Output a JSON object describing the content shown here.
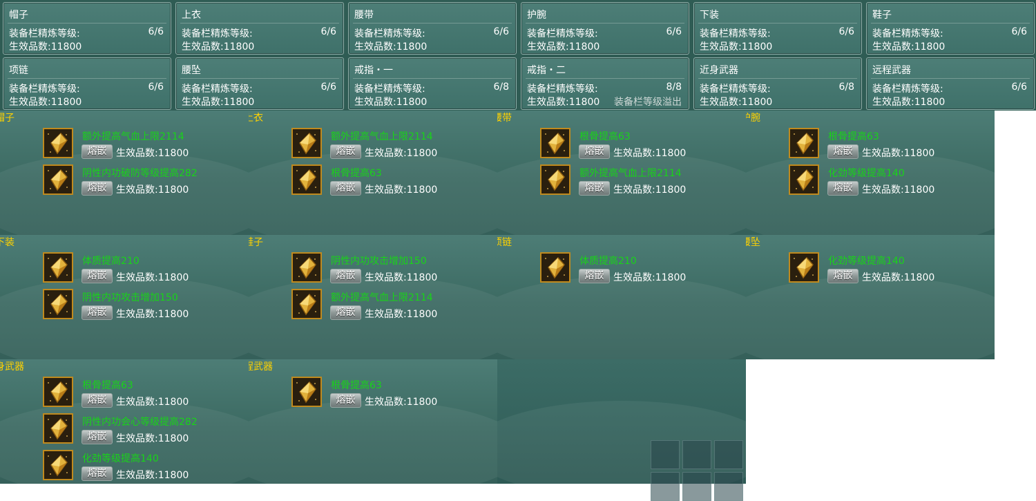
{
  "slots": [
    {
      "name": "帽子",
      "level_label": "装备栏精炼等级:",
      "level": "6/6",
      "count_label": "生效品数:",
      "count": "11800",
      "note": ""
    },
    {
      "name": "上衣",
      "level_label": "装备栏精炼等级:",
      "level": "6/6",
      "count_label": "生效品数:",
      "count": "11800",
      "note": ""
    },
    {
      "name": "腰带",
      "level_label": "装备栏精炼等级:",
      "level": "6/6",
      "count_label": "生效品数:",
      "count": "11800",
      "note": ""
    },
    {
      "name": "护腕",
      "level_label": "装备栏精炼等级:",
      "level": "6/6",
      "count_label": "生效品数:",
      "count": "11800",
      "note": ""
    },
    {
      "name": "下装",
      "level_label": "装备栏精炼等级:",
      "level": "6/6",
      "count_label": "生效品数:",
      "count": "11800",
      "note": ""
    },
    {
      "name": "鞋子",
      "level_label": "装备栏精炼等级:",
      "level": "6/6",
      "count_label": "生效品数:",
      "count": "11800",
      "note": ""
    },
    {
      "name": "项链",
      "level_label": "装备栏精炼等级:",
      "level": "6/6",
      "count_label": "生效品数:",
      "count": "11800",
      "note": ""
    },
    {
      "name": "腰坠",
      "level_label": "装备栏精炼等级:",
      "level": "6/6",
      "count_label": "生效品数:",
      "count": "11800",
      "note": ""
    },
    {
      "name": "戒指・一",
      "level_label": "装备栏精炼等级:",
      "level": "6/8",
      "count_label": "生效品数:",
      "count": "11800",
      "note": ""
    },
    {
      "name": "戒指・二",
      "level_label": "装备栏精炼等级:",
      "level": "8/8",
      "count_label": "生效品数:",
      "count": "11800",
      "note": "装备栏等级溢出"
    },
    {
      "name": "近身武器",
      "level_label": "装备栏精炼等级:",
      "level": "6/8",
      "count_label": "生效品数:",
      "count": "11800",
      "note": ""
    },
    {
      "name": "远程武器",
      "level_label": "装备栏精炼等级:",
      "level": "6/6",
      "count_label": "生效品数:",
      "count": "11800",
      "note": ""
    }
  ],
  "panels": [
    {
      "title": "帽子",
      "gems": [
        {
          "effect": "额外提高气血上限2114",
          "button": "熔嵌",
          "count_label": "生效品数:",
          "count": "11800"
        },
        {
          "effect": "阴性内功破防等级提高282",
          "button": "熔嵌",
          "count_label": "生效品数:",
          "count": "11800"
        }
      ]
    },
    {
      "title": "上衣",
      "gems": [
        {
          "effect": "额外提高气血上限2114",
          "button": "熔嵌",
          "count_label": "生效品数:",
          "count": "11800"
        },
        {
          "effect": "根骨提高63",
          "button": "熔嵌",
          "count_label": "生效品数:",
          "count": "11800"
        }
      ]
    },
    {
      "title": "腰带",
      "gems": [
        {
          "effect": "根骨提高63",
          "button": "熔嵌",
          "count_label": "生效品数:",
          "count": "11800"
        },
        {
          "effect": "额外提高气血上限2114",
          "button": "熔嵌",
          "count_label": "生效品数:",
          "count": "11800"
        }
      ]
    },
    {
      "title": "护腕",
      "gems": [
        {
          "effect": "根骨提高63",
          "button": "熔嵌",
          "count_label": "生效品数:",
          "count": "11800"
        },
        {
          "effect": "化劲等级提高140",
          "button": "熔嵌",
          "count_label": "生效品数:",
          "count": "11800"
        }
      ]
    },
    {
      "title": "下装",
      "gems": [
        {
          "effect": "体质提高210",
          "button": "熔嵌",
          "count_label": "生效品数:",
          "count": "11800"
        },
        {
          "effect": "阴性内功攻击增加150",
          "button": "熔嵌",
          "count_label": "生效品数:",
          "count": "11800"
        }
      ]
    },
    {
      "title": "鞋子",
      "gems": [
        {
          "effect": "阴性内功攻击增加150",
          "button": "熔嵌",
          "count_label": "生效品数:",
          "count": "11800"
        },
        {
          "effect": "额外提高气血上限2114",
          "button": "熔嵌",
          "count_label": "生效品数:",
          "count": "11800"
        }
      ]
    },
    {
      "title": "项链",
      "gems": [
        {
          "effect": "体质提高210",
          "button": "熔嵌",
          "count_label": "生效品数:",
          "count": "11800"
        }
      ]
    },
    {
      "title": "腰坠",
      "gems": [
        {
          "effect": "化劲等级提高140",
          "button": "熔嵌",
          "count_label": "生效品数:",
          "count": "11800"
        }
      ]
    },
    {
      "title": "近身武器",
      "gems": [
        {
          "effect": "根骨提高63",
          "button": "熔嵌",
          "count_label": "生效品数:",
          "count": "11800"
        },
        {
          "effect": "阴性内功会心等级提高282",
          "button": "熔嵌",
          "count_label": "生效品数:",
          "count": "11800"
        },
        {
          "effect": "化劲等级提高140",
          "button": "熔嵌",
          "count_label": "生效品数:",
          "count": "11800"
        }
      ]
    },
    {
      "title": "远程武器",
      "gems": [
        {
          "effect": "根骨提高63",
          "button": "熔嵌",
          "count_label": "生效品数:",
          "count": "11800"
        }
      ]
    }
  ],
  "colors": {
    "title": "#ffd200",
    "effect": "#19d319",
    "gem_border": "#c08a1e",
    "panel": "#3f716a"
  },
  "icons": {
    "gem": "gold-crystal-gem-icon"
  }
}
